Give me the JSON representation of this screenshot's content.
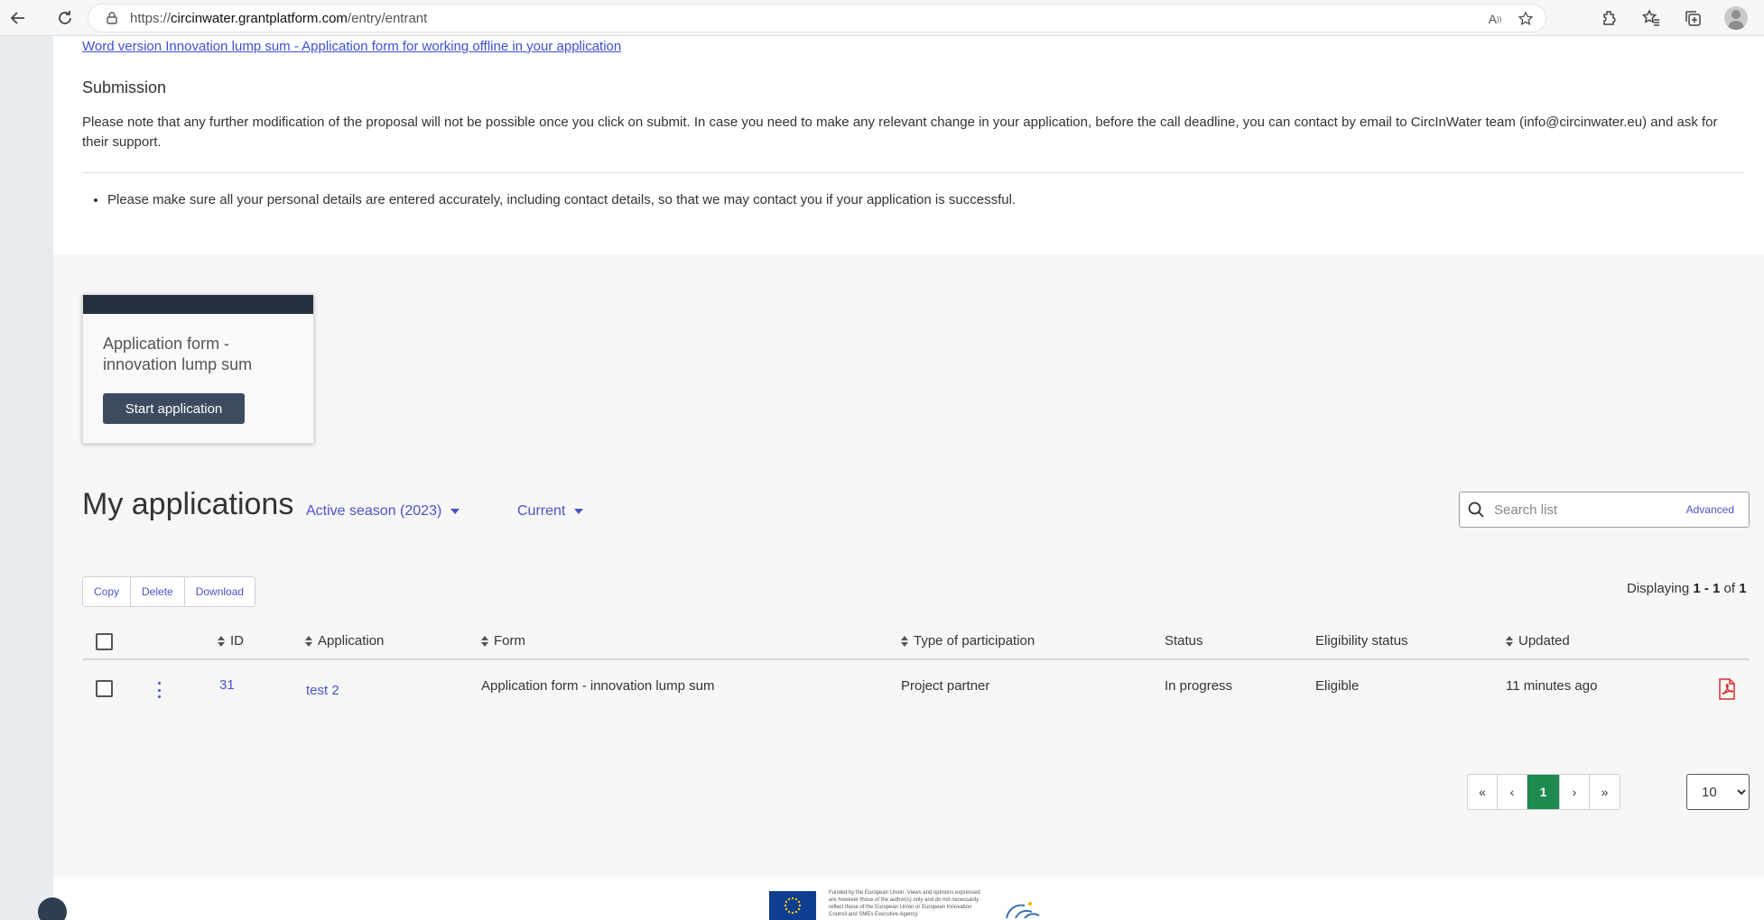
{
  "browser": {
    "url_prefix": "https://",
    "url_domain": "circinwater.grantplatform.com",
    "url_path": "/entry/entrant"
  },
  "top": {
    "word_link": "Word version Innovation lump sum - Application form for working offline in your application",
    "submission_title": "Submission",
    "submission_text": "Please note that any further modification of the proposal will not be possible once you click on submit. In case you need to make any relevant change in your application, before the call deadline, you can contact by email to CircInWater team (info@circinwater.eu) and ask for their support.",
    "bullet": "Please make sure all your personal details are entered accurately, including contact details, so that we may contact you if your application is successful."
  },
  "card": {
    "title": "Application form - innovation lump sum",
    "button": "Start application"
  },
  "my_applications": {
    "title": "My applications",
    "season_filter": "Active season (2023)",
    "status_filter": "Current",
    "search_placeholder": "Search list",
    "advanced": "Advanced",
    "actions": [
      "Copy",
      "Delete",
      "Download"
    ],
    "displaying_prefix": "Displaying ",
    "displaying_range": "1 - 1",
    "displaying_of": " of ",
    "displaying_total": "1"
  },
  "table": {
    "headers": {
      "id": "ID",
      "application": "Application",
      "form": "Form",
      "type": "Type of participation",
      "status": "Status",
      "eligibility": "Eligibility status",
      "updated": "Updated"
    },
    "rows": [
      {
        "id": "31",
        "application": "test 2",
        "form": "Application form - innovation lump sum",
        "type": "Project partner",
        "status": "In progress",
        "eligibility": "Eligible",
        "updated": "11 minutes ago"
      }
    ]
  },
  "pagination": {
    "first": "«",
    "prev": "‹",
    "current": "1",
    "next": "›",
    "last": "»",
    "page_size": "10"
  },
  "footer": {
    "disclaimer": "Funded by the European Union. Views and opinions expressed are however those of the author(s) only and do not necessarily reflect those of the European Union or European Innovation Council and SMEs Executive Agency."
  },
  "colors": {
    "accent": "#4a52c8",
    "card_header": "#25303e",
    "button": "#3c4b5f",
    "active_page": "#1e8a4f",
    "pdf": "#d9302c"
  }
}
